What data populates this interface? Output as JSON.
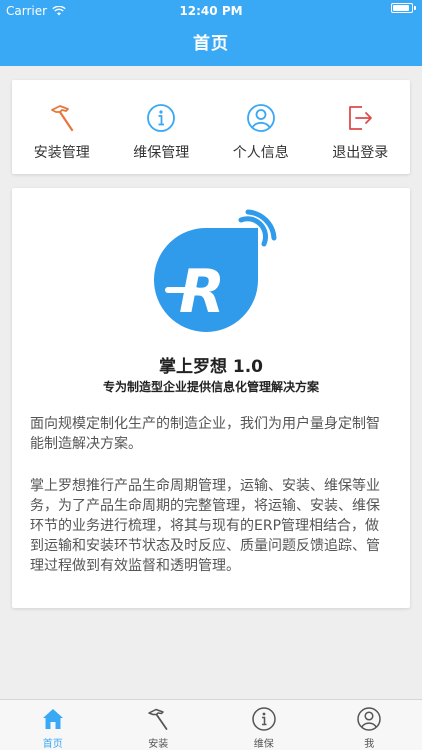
{
  "status_bar": {
    "carrier": "Carrier",
    "time": "12:40 PM",
    "battery_level": 0.9
  },
  "nav": {
    "title": "首页"
  },
  "menu": [
    {
      "label": "安装管理",
      "icon": "hammer-icon"
    },
    {
      "label": "维保管理",
      "icon": "info-icon"
    },
    {
      "label": "个人信息",
      "icon": "user-icon"
    },
    {
      "label": "退出登录",
      "icon": "logout-icon"
    }
  ],
  "info": {
    "title": "掌上罗想 1.0",
    "subtitle": "专为制造型企业提供信息化管理解决方案",
    "para1": "面向规模定制化生产的制造企业，我们为用户量身定制智能制造解决方案。",
    "para2": "掌上罗想推行产品生命周期管理，运输、安装、维保等业务，为了产品生命周期的完整管理，将运输、安装、维保环节的业务进行梳理，将其与现有的ERP管理相结合，做到运输和安装环节状态及时反应、质量问题反馈追踪、管理过程做到有效监督和透明管理。"
  },
  "tabs": [
    {
      "label": "首页",
      "icon": "home-icon",
      "active": true
    },
    {
      "label": "安装",
      "icon": "hammer-icon"
    },
    {
      "label": "维保",
      "icon": "info-icon"
    },
    {
      "label": "我",
      "icon": "user-icon"
    }
  ],
  "colors": {
    "primary": "#39a8f5",
    "accent_orange": "#e8763a",
    "accent_red": "#e04a4a"
  }
}
